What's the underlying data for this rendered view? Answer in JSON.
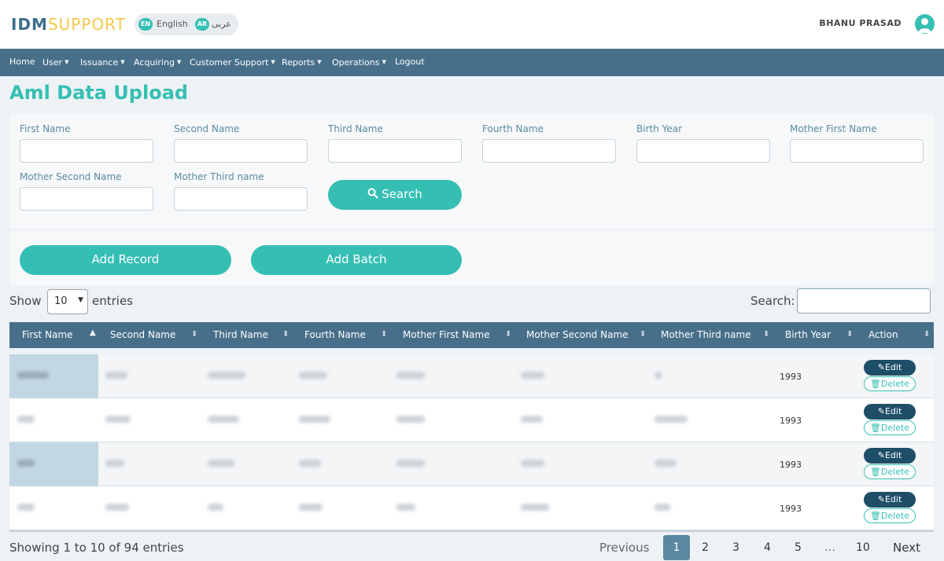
{
  "brand": {
    "part1": "IDM",
    "part2": "SUPPORT"
  },
  "language": {
    "en_badge": "EN",
    "en_label": "English",
    "ar_badge": "AR",
    "ar_label": "عربى"
  },
  "user": {
    "name": "BHANU PRASAD"
  },
  "nav": {
    "home": "Home",
    "user": "User",
    "issuance": "Issuance",
    "acquiring": "Acquiring",
    "customer_support": "Customer Support",
    "reports": "Reports",
    "operations": "Operations",
    "logout": "Logout"
  },
  "page": {
    "title": "Aml Data Upload"
  },
  "filters": {
    "first_name": "First Name",
    "second_name": "Second Name",
    "third_name": "Third Name",
    "fourth_name": "Fourth Name",
    "birth_year": "Birth Year",
    "mother_first_name": "Mother First Name",
    "mother_second_name": "Mother Second Name",
    "mother_third_name": "Mother Third name",
    "search_button": "Search"
  },
  "actions": {
    "add_record": "Add Record",
    "add_batch": "Add Batch"
  },
  "table_controls": {
    "show": "Show",
    "entries_value": "10",
    "entries": "entries",
    "search_label": "Search:"
  },
  "table": {
    "headers": {
      "first_name": "First Name",
      "second_name": "Second Name",
      "third_name": "Third Name",
      "fourth_name": "Fourth Name",
      "mother_first_name": "Mother First Name",
      "mother_second_name": "Mother Second Name",
      "mother_third_name": "Mother Third name",
      "birth_year": "Birth Year",
      "action": "Action"
    },
    "rows": [
      {
        "birth_year": "1993",
        "edit": "Edit",
        "delete": "Delete"
      },
      {
        "birth_year": "1993",
        "edit": "Edit",
        "delete": "Delete"
      },
      {
        "birth_year": "1993",
        "edit": "Edit",
        "delete": "Delete"
      },
      {
        "birth_year": "1993",
        "edit": "Edit",
        "delete": "Delete"
      }
    ]
  },
  "footer": {
    "info": "Showing 1 to 10 of 94 entries",
    "previous": "Previous",
    "next": "Next",
    "pages": [
      "1",
      "2",
      "3",
      "4",
      "5",
      "…",
      "10"
    ]
  },
  "colors": {
    "accent": "#35bfb3",
    "nav": "#476f8a",
    "title": "#35bfb3",
    "edit": "#1e4e68"
  }
}
